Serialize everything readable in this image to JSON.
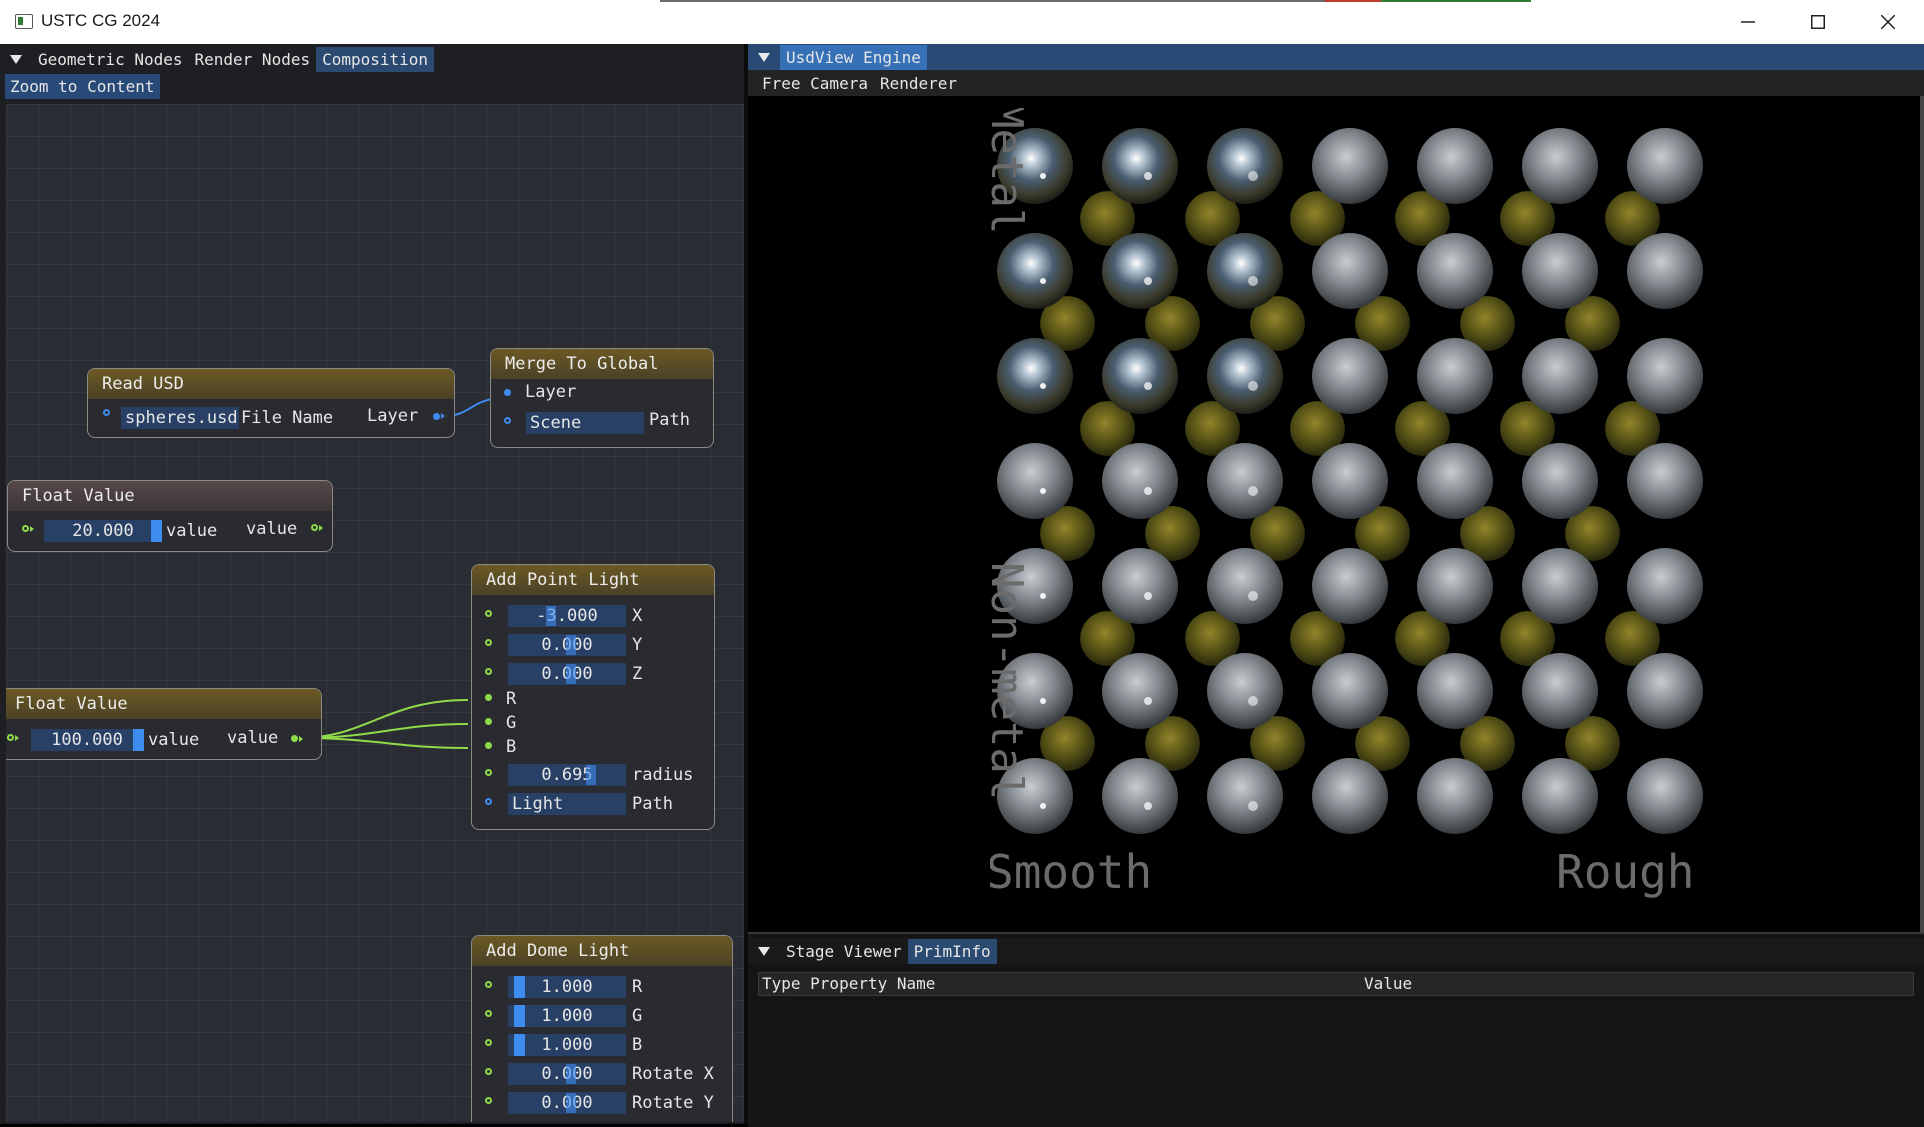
{
  "window": {
    "title": "USTC CG 2024",
    "controls": [
      "minimize",
      "maximize",
      "close"
    ]
  },
  "node_editor": {
    "tabs": [
      "Geometric Nodes",
      "Render Nodes",
      "Composition"
    ],
    "active_tab": "Composition",
    "zoom_button": "Zoom to Content",
    "nodes": {
      "read_usd": {
        "title": "Read USD",
        "file_value": "spheres.usd",
        "file_label": "File Name",
        "output_label": "Layer"
      },
      "merge_to_global": {
        "title": "Merge To Global",
        "input_label": "Layer",
        "path_value": "Scene",
        "path_label": "Path"
      },
      "float_value_1": {
        "title": "Float Value",
        "value": "20.000",
        "input_label": "value",
        "output_label": "value"
      },
      "float_value_2": {
        "title": "Float Value",
        "value": "100.000",
        "input_label": "value",
        "output_label": "value"
      },
      "add_point_light": {
        "title": "Add Point Light",
        "x": {
          "value": "-3.000",
          "label": "X"
        },
        "y": {
          "value": "0.000",
          "label": "Y"
        },
        "z": {
          "value": "0.000",
          "label": "Z"
        },
        "r_label": "R",
        "g_label": "G",
        "b_label": "B",
        "radius": {
          "value": "0.695",
          "label": "radius"
        },
        "path": {
          "value": "Light",
          "label": "Path"
        }
      },
      "add_dome_light": {
        "title": "Add Dome Light",
        "r": {
          "value": "1.000",
          "label": "R"
        },
        "g": {
          "value": "1.000",
          "label": "G"
        },
        "b": {
          "value": "1.000",
          "label": "B"
        },
        "rotate_x": {
          "value": "0.000",
          "label": "Rotate X"
        },
        "rotate_y": {
          "value": "0.000",
          "label": "Rotate Y"
        }
      }
    }
  },
  "usdview": {
    "tab": "UsdView Engine",
    "menu": [
      "Free Camera",
      "Renderer"
    ],
    "labels": {
      "metal": "Metal",
      "non_metal": "Non-metal",
      "smooth": "Smooth",
      "rough": "Rough"
    }
  },
  "stage": {
    "tabs": [
      "Stage Viewer",
      "PrimInfo"
    ],
    "active_tab": "PrimInfo",
    "columns": [
      "Type Property Name",
      "Value"
    ]
  },
  "colors": {
    "accent": "#3f8cf0",
    "pin_green": "#8fdc4a",
    "active_tab": "#294a74",
    "node_header_gold": "#6c5a24"
  }
}
